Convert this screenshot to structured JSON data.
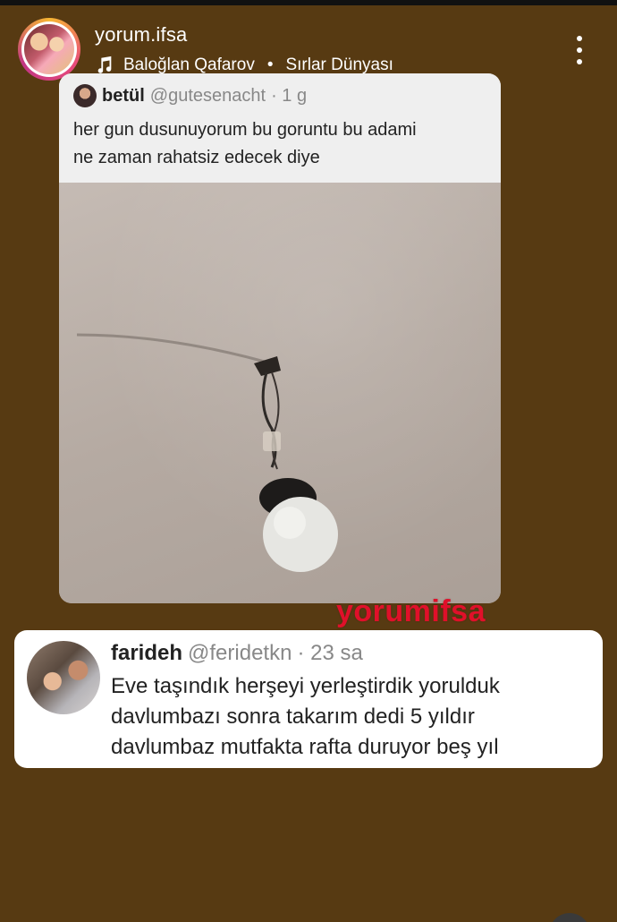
{
  "header": {
    "username": "yorum.ifsa",
    "music": {
      "artist": "Baloğlan Qafarov",
      "separator": "•",
      "song": "Sırlar Dünyası"
    }
  },
  "post": {
    "author_name": "betül",
    "author_handle": "@gutesenacht",
    "time": "· 1 g",
    "text_line1": "her gun dusunuyorum bu goruntu bu adami",
    "text_line2": "ne zaman rahatsiz edecek diye"
  },
  "watermark": "yorumifsa",
  "reply": {
    "author_name": "farideh",
    "author_handle": "@feridetkn",
    "time": "· 23 sa",
    "line1": "Eve taşındık herşeyi yerleştirdik yorulduk",
    "line2": "davlumbazı sonra takarım dedi 5 yıldır",
    "line3": "davlumbaz mutfakta rafta duruyor beş yıl"
  },
  "colors": {
    "background": "#573a12",
    "watermark": "#e0102a",
    "card": "#ffffff"
  }
}
